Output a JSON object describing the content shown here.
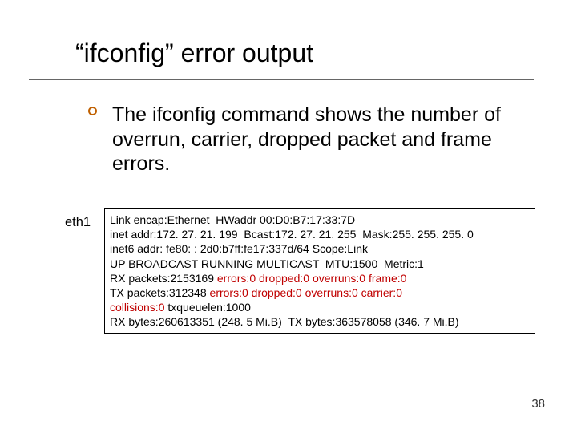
{
  "title": "“ifconfig” error output",
  "bullet": "The ifconfig command shows the number of overrun, carrier, dropped packet and frame errors.",
  "iface": "eth1",
  "out": {
    "l1": "Link encap:Ethernet  HWaddr 00:D0:B7:17:33:7D",
    "l2": "inet addr:172. 27. 21. 199  Bcast:172. 27. 21. 255  Mask:255. 255. 255. 0",
    "l3": "inet6 addr: fe80: : 2d0:b7ff:fe17:337d/64 Scope:Link",
    "l4": "UP BROADCAST RUNNING MULTICAST  MTU:1500  Metric:1",
    "l5a": "RX packets:2153169 ",
    "l5b": "errors:0 dropped:0 overruns:0 frame:0",
    "l6a": "TX packets:312348 ",
    "l6b": "errors:0 dropped:0 overruns:0 carrier:0",
    "l7a": "collisions:0",
    "l7b": " txqueuelen:1000",
    "l8": "RX bytes:260613351 (248. 5 Mi.B)  TX bytes:363578058 (346. 7 Mi.B)"
  },
  "page": "38"
}
